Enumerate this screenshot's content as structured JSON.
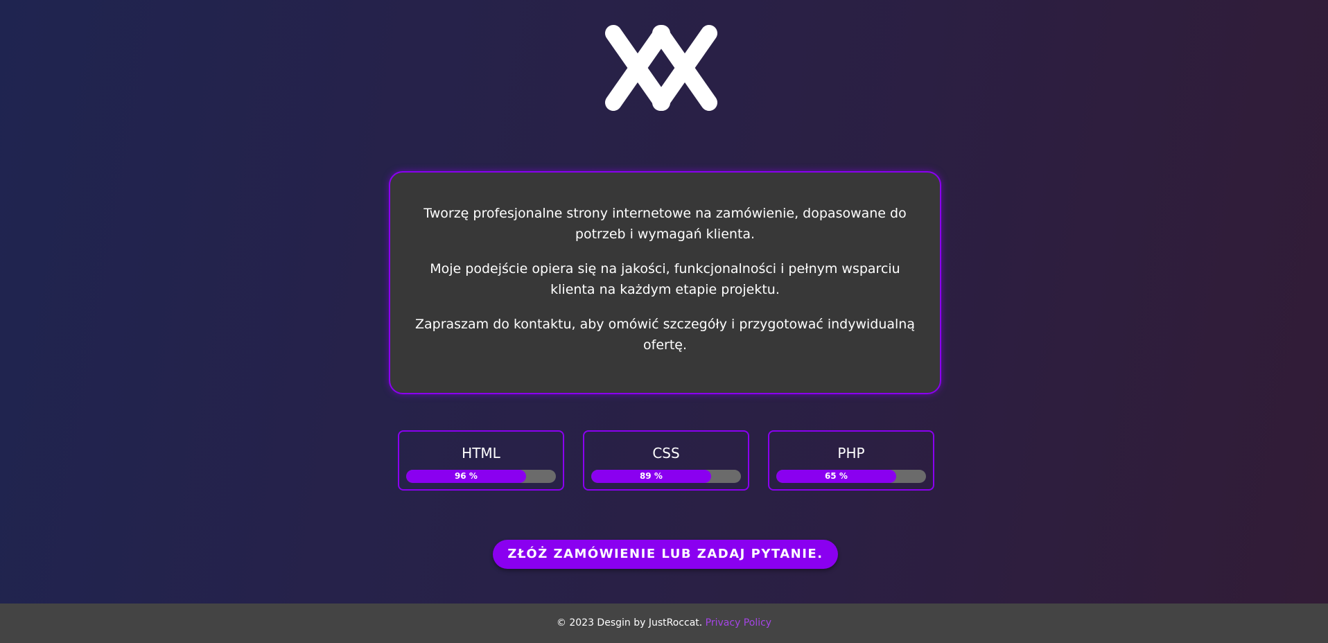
{
  "logo": {
    "icon": "double-x-logo-icon",
    "color": "#ffffff"
  },
  "about": {
    "paragraphs": [
      "Tworzę profesjonalne strony internetowe na zamówienie, dopasowane do potrzeb i wymagań klienta.",
      "Moje podejście opiera się na jakości, funkcjonalności i pełnym wsparciu klienta na każdym etapie projektu.",
      "Zapraszam do kontaktu, aby omówić szczegóły i przygotować indywidualną ofertę."
    ]
  },
  "skills": [
    {
      "name": "HTML",
      "percent_label": "96 %",
      "level": 0.8
    },
    {
      "name": "CSS",
      "percent_label": "89 %",
      "level": 0.8
    },
    {
      "name": "PHP",
      "percent_label": "65 %",
      "level": 0.8
    }
  ],
  "cta": {
    "label": "ZŁÓŻ ZAMÓWIENIE LUB ZADAJ PYTANIE."
  },
  "footer": {
    "copyright": "© 2023 Desgin by JustRoccat.",
    "privacy_label": "Privacy Policy"
  },
  "colors": {
    "accent": "#8a00f0",
    "card_bg": "#383838",
    "footer_bg": "#444444",
    "link": "#a545e6"
  }
}
